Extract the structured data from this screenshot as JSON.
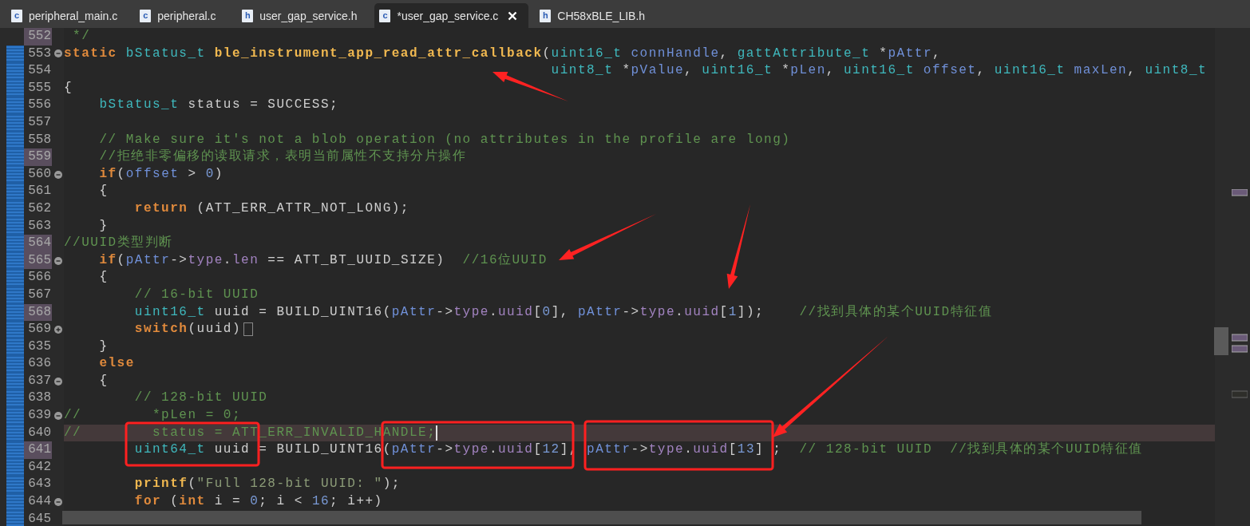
{
  "tabs": [
    {
      "icon_text": "c",
      "label": "peripheral_main.c",
      "selected": false
    },
    {
      "icon_text": "c",
      "label": "peripheral.c",
      "selected": false
    },
    {
      "icon_text": "h",
      "label": "user_gap_service.h",
      "selected": false
    },
    {
      "icon_text": "c",
      "label": "*user_gap_service.c",
      "selected": true
    },
    {
      "icon_text": "h",
      "label": "CH58xBLE_LIB.h",
      "selected": false
    }
  ],
  "editor": {
    "lines": [
      {
        "number": "552",
        "changed": false,
        "highlighted": true,
        "current": false,
        "fold_marker": false,
        "collapsed": false,
        "segments": [
          {
            "kind": "comment",
            "text": " */"
          }
        ]
      },
      {
        "number": "553",
        "changed": true,
        "highlighted": false,
        "current": false,
        "fold_marker": true,
        "collapsed": false,
        "segments": [
          {
            "kind": "keyword",
            "text": "static"
          },
          {
            "kind": "type",
            "text": " bStatus_t"
          },
          {
            "kind": "function",
            "text": " ble_instrument_app_read_attr_callback"
          },
          {
            "kind": "plain",
            "text": "("
          },
          {
            "kind": "type",
            "text": "uint16_t"
          },
          {
            "kind": "variable",
            "text": " connHandle"
          },
          {
            "kind": "plain",
            "text": ", "
          },
          {
            "kind": "type",
            "text": "gattAttribute_t"
          },
          {
            "kind": "plain",
            "text": " *"
          },
          {
            "kind": "variable",
            "text": "pAttr"
          },
          {
            "kind": "plain",
            "text": ","
          }
        ]
      },
      {
        "number": "554",
        "changed": true,
        "highlighted": false,
        "current": false,
        "fold_marker": false,
        "collapsed": false,
        "segments": [
          {
            "kind": "type",
            "text": "                                                       uint8_t"
          },
          {
            "kind": "plain",
            "text": " *"
          },
          {
            "kind": "variable",
            "text": "pValue"
          },
          {
            "kind": "plain",
            "text": ", "
          },
          {
            "kind": "type",
            "text": "uint16_t"
          },
          {
            "kind": "plain",
            "text": " *"
          },
          {
            "kind": "variable",
            "text": "pLen"
          },
          {
            "kind": "plain",
            "text": ", "
          },
          {
            "kind": "type",
            "text": "uint16_t"
          },
          {
            "kind": "variable",
            "text": " offset"
          },
          {
            "kind": "plain",
            "text": ", "
          },
          {
            "kind": "type",
            "text": "uint16_t"
          },
          {
            "kind": "variable",
            "text": " maxLen"
          },
          {
            "kind": "plain",
            "text": ", "
          },
          {
            "kind": "type",
            "text": "uint8_t"
          }
        ]
      },
      {
        "number": "555",
        "changed": true,
        "highlighted": false,
        "current": false,
        "fold_marker": false,
        "collapsed": false,
        "segments": [
          {
            "kind": "plain",
            "text": "{"
          }
        ]
      },
      {
        "number": "556",
        "changed": true,
        "highlighted": false,
        "current": false,
        "fold_marker": false,
        "collapsed": false,
        "segments": [
          {
            "kind": "type",
            "text": "    bStatus_t"
          },
          {
            "kind": "plain",
            "text": " status = SUCCESS;"
          }
        ]
      },
      {
        "number": "557",
        "changed": true,
        "highlighted": false,
        "current": false,
        "fold_marker": false,
        "collapsed": false
      },
      {
        "number": "558",
        "changed": true,
        "highlighted": false,
        "current": false,
        "fold_marker": false,
        "collapsed": false,
        "segments": [
          {
            "kind": "comment",
            "text": "    // Make sure it's not a blob operation (no attributes in the profile are long)"
          }
        ]
      },
      {
        "number": "559",
        "changed": true,
        "highlighted": true,
        "current": false,
        "fold_marker": false,
        "collapsed": false,
        "segments": [
          {
            "kind": "comment",
            "text": "    //拒绝非零偏移的读取请求，表明当前属性不支持分片操作"
          }
        ]
      },
      {
        "number": "560",
        "changed": true,
        "highlighted": false,
        "current": false,
        "fold_marker": true,
        "collapsed": false,
        "segments": [
          {
            "kind": "keyword",
            "text": "    if"
          },
          {
            "kind": "plain",
            "text": "("
          },
          {
            "kind": "variable",
            "text": "offset"
          },
          {
            "kind": "plain",
            "text": " > "
          },
          {
            "kind": "number",
            "text": "0"
          },
          {
            "kind": "plain",
            "text": ")"
          }
        ]
      },
      {
        "number": "561",
        "changed": true,
        "highlighted": false,
        "current": false,
        "fold_marker": false,
        "collapsed": false,
        "segments": [
          {
            "kind": "plain",
            "text": "    {"
          }
        ]
      },
      {
        "number": "562",
        "changed": true,
        "highlighted": false,
        "current": false,
        "fold_marker": false,
        "collapsed": false,
        "segments": [
          {
            "kind": "keyword",
            "text": "        return"
          },
          {
            "kind": "plain",
            "text": " (ATT_ERR_ATTR_NOT_LONG);"
          }
        ]
      },
      {
        "number": "563",
        "changed": true,
        "highlighted": false,
        "current": false,
        "fold_marker": false,
        "collapsed": false,
        "segments": [
          {
            "kind": "plain",
            "text": "    }"
          }
        ]
      },
      {
        "number": "564",
        "changed": true,
        "highlighted": true,
        "current": false,
        "fold_marker": false,
        "collapsed": false,
        "segments": [
          {
            "kind": "comment",
            "text": "//UUID类型判断"
          }
        ]
      },
      {
        "number": "565",
        "changed": true,
        "highlighted": true,
        "current": false,
        "fold_marker": true,
        "collapsed": false,
        "segments": [
          {
            "kind": "keyword",
            "text": "    if"
          },
          {
            "kind": "plain",
            "text": "("
          },
          {
            "kind": "variable",
            "text": "pAttr"
          },
          {
            "kind": "plain",
            "text": "->"
          },
          {
            "kind": "field",
            "text": "type"
          },
          {
            "kind": "plain",
            "text": "."
          },
          {
            "kind": "field",
            "text": "len"
          },
          {
            "kind": "plain",
            "text": " == ATT_BT_UUID_SIZE)"
          },
          {
            "kind": "comment",
            "text": "  //16位UUID"
          }
        ]
      },
      {
        "number": "566",
        "changed": true,
        "highlighted": false,
        "current": false,
        "fold_marker": false,
        "collapsed": false,
        "segments": [
          {
            "kind": "plain",
            "text": "    {"
          }
        ]
      },
      {
        "number": "567",
        "changed": true,
        "highlighted": false,
        "current": false,
        "fold_marker": false,
        "collapsed": false,
        "segments": [
          {
            "kind": "comment",
            "text": "        // 16-bit UUID"
          }
        ]
      },
      {
        "number": "568",
        "changed": true,
        "highlighted": true,
        "current": false,
        "fold_marker": false,
        "collapsed": false,
        "segments": [
          {
            "kind": "type",
            "text": "        uint16_t"
          },
          {
            "kind": "plain",
            "text": " uuid = BUILD_UINT16("
          },
          {
            "kind": "variable",
            "text": "pAttr"
          },
          {
            "kind": "plain",
            "text": "->"
          },
          {
            "kind": "field",
            "text": "type"
          },
          {
            "kind": "plain",
            "text": "."
          },
          {
            "kind": "field",
            "text": "uuid"
          },
          {
            "kind": "plain",
            "text": "["
          },
          {
            "kind": "number",
            "text": "0"
          },
          {
            "kind": "plain",
            "text": "], "
          },
          {
            "kind": "variable",
            "text": "pAttr"
          },
          {
            "kind": "plain",
            "text": "->"
          },
          {
            "kind": "field",
            "text": "type"
          },
          {
            "kind": "plain",
            "text": "."
          },
          {
            "kind": "field",
            "text": "uuid"
          },
          {
            "kind": "plain",
            "text": "["
          },
          {
            "kind": "number",
            "text": "1"
          },
          {
            "kind": "plain",
            "text": "]);"
          },
          {
            "kind": "comment",
            "text": "    //找到具体的某个UUID特征值"
          }
        ]
      },
      {
        "number": "569",
        "changed": true,
        "highlighted": false,
        "current": false,
        "fold_marker": true,
        "collapsed": true,
        "segments": [
          {
            "kind": "keyword",
            "text": "        switch"
          },
          {
            "kind": "plain",
            "text": "(uuid)"
          }
        ]
      },
      {
        "number": "635",
        "changed": true,
        "highlighted": false,
        "current": false,
        "fold_marker": false,
        "collapsed": false,
        "segments": [
          {
            "kind": "plain",
            "text": "    }"
          }
        ]
      },
      {
        "number": "636",
        "changed": true,
        "highlighted": false,
        "current": false,
        "fold_marker": false,
        "collapsed": false,
        "segments": [
          {
            "kind": "keyword",
            "text": "    else"
          }
        ]
      },
      {
        "number": "637",
        "changed": true,
        "highlighted": false,
        "current": false,
        "fold_marker": true,
        "collapsed": false,
        "segments": [
          {
            "kind": "plain",
            "text": "    {"
          }
        ]
      },
      {
        "number": "638",
        "changed": true,
        "highlighted": false,
        "current": false,
        "fold_marker": false,
        "collapsed": false,
        "segments": [
          {
            "kind": "comment",
            "text": "        // 128-bit UUID"
          }
        ]
      },
      {
        "number": "639",
        "changed": true,
        "highlighted": false,
        "current": false,
        "fold_marker": true,
        "collapsed": false,
        "segments": [
          {
            "kind": "comment",
            "text": "//        *pLen = 0;"
          }
        ]
      },
      {
        "number": "640",
        "changed": true,
        "highlighted": false,
        "current": true,
        "fold_marker": false,
        "collapsed": false,
        "segments": [
          {
            "kind": "comment",
            "text": "//        status = ATT_ERR_INVALID_HANDLE;"
          }
        ]
      },
      {
        "number": "641",
        "changed": true,
        "highlighted": true,
        "current": false,
        "fold_marker": false,
        "collapsed": false,
        "segments": [
          {
            "kind": "type",
            "text": "        uint64_t"
          },
          {
            "kind": "plain",
            "text": " uuid = BUILD_UINT16("
          },
          {
            "kind": "variable",
            "text": "pAttr"
          },
          {
            "kind": "plain",
            "text": "->"
          },
          {
            "kind": "field",
            "text": "type"
          },
          {
            "kind": "plain",
            "text": "."
          },
          {
            "kind": "field",
            "text": "uuid"
          },
          {
            "kind": "plain",
            "text": "["
          },
          {
            "kind": "number",
            "text": "12"
          },
          {
            "kind": "plain",
            "text": "], "
          },
          {
            "kind": "variable",
            "text": "pAttr"
          },
          {
            "kind": "plain",
            "text": "->"
          },
          {
            "kind": "field",
            "text": "type"
          },
          {
            "kind": "plain",
            "text": "."
          },
          {
            "kind": "field",
            "text": "uuid"
          },
          {
            "kind": "plain",
            "text": "["
          },
          {
            "kind": "number",
            "text": "13"
          },
          {
            "kind": "plain",
            "text": "] ;"
          },
          {
            "kind": "comment",
            "text": "  // 128-bit UUID  //找到具体的某个UUID特征值"
          }
        ]
      },
      {
        "number": "642",
        "changed": true,
        "highlighted": false,
        "current": false,
        "fold_marker": false,
        "collapsed": false
      },
      {
        "number": "643",
        "changed": true,
        "highlighted": false,
        "current": false,
        "fold_marker": false,
        "collapsed": false,
        "segments": [
          {
            "kind": "function",
            "text": "        printf"
          },
          {
            "kind": "plain",
            "text": "("
          },
          {
            "kind": "string",
            "text": "\"Full 128-bit UUID: \""
          },
          {
            "kind": "plain",
            "text": ");"
          }
        ]
      },
      {
        "number": "644",
        "changed": true,
        "highlighted": false,
        "current": false,
        "fold_marker": true,
        "collapsed": false,
        "segments": [
          {
            "kind": "keyword",
            "text": "        for"
          },
          {
            "kind": "plain",
            "text": " ("
          },
          {
            "kind": "keyword",
            "text": "int"
          },
          {
            "kind": "plain",
            "text": " i = "
          },
          {
            "kind": "number",
            "text": "0"
          },
          {
            "kind": "plain",
            "text": "; i < "
          },
          {
            "kind": "number",
            "text": "16"
          },
          {
            "kind": "plain",
            "text": "; i++)"
          }
        ]
      },
      {
        "number": "645",
        "changed": true,
        "highlighted": false,
        "current": false,
        "fold_marker": false,
        "collapsed": false
      }
    ]
  }
}
